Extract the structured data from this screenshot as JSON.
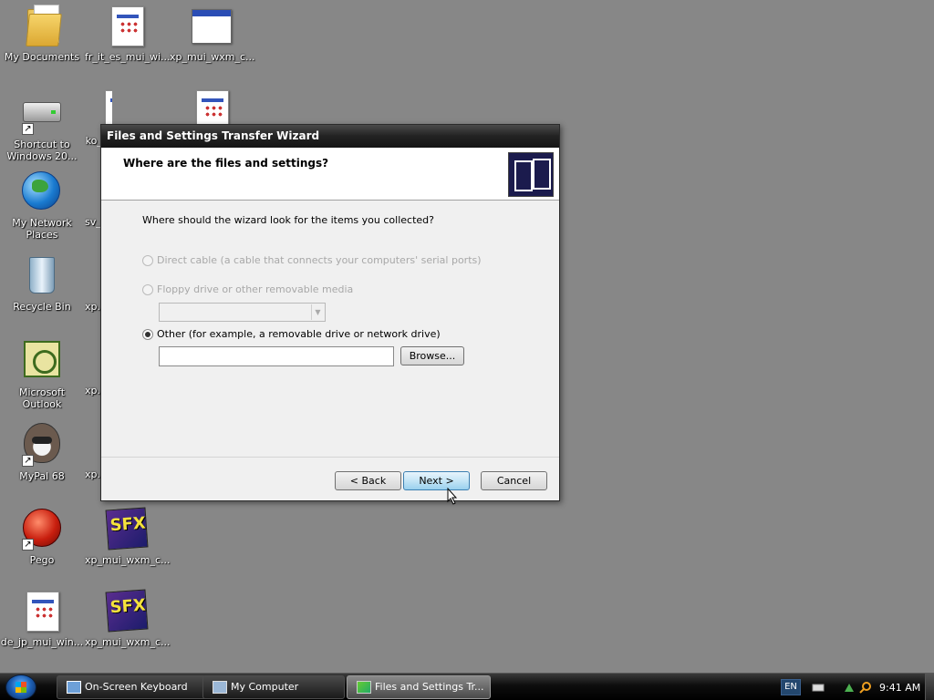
{
  "desktop": {
    "icons": [
      {
        "label": "My Documents"
      },
      {
        "label": "fr_it_es_mui_wi..."
      },
      {
        "label": "xp_mui_wxm_c..."
      },
      {
        "label": "Shortcut to\nWindows 20..."
      },
      {
        "label": "ko_..."
      },
      {
        "label": ""
      },
      {
        "label": "My Network\nPlaces"
      },
      {
        "label": "sv_..."
      },
      {
        "label": "Recycle Bin"
      },
      {
        "label": "xp..."
      },
      {
        "label": "Microsoft\nOutlook"
      },
      {
        "label": "xp..."
      },
      {
        "label": "MyPal 68"
      },
      {
        "label": "xp..."
      },
      {
        "label": "Pego"
      },
      {
        "label": "xp_mui_wxm_c..."
      },
      {
        "label": "de_jp_mui_win..."
      },
      {
        "label": "xp_mui_wxm_c..."
      }
    ]
  },
  "dialog": {
    "title": "Files and Settings Transfer Wizard",
    "heading": "Where are the files and settings?",
    "question": "Where should the wizard look for the items you collected?",
    "options": [
      {
        "label": "Direct cable (a cable that connects your computers' serial ports)",
        "checked": false,
        "disabled": true
      },
      {
        "label": "Floppy drive or other removable media",
        "checked": false,
        "disabled": true
      },
      {
        "label": "Other (for example, a removable drive or network drive)",
        "checked": true,
        "disabled": false
      }
    ],
    "combo_value": "",
    "path_value": "",
    "browse_label": "Browse...",
    "back_label": "< Back",
    "next_label": "Next >",
    "cancel_label": "Cancel"
  },
  "taskbar": {
    "items": [
      {
        "label": "On-Screen Keyboard",
        "active": false
      },
      {
        "label": "My Computer",
        "active": false
      },
      {
        "label": "Files and Settings Tr...",
        "active": true
      }
    ],
    "language": "EN",
    "clock": "9:41 AM"
  }
}
